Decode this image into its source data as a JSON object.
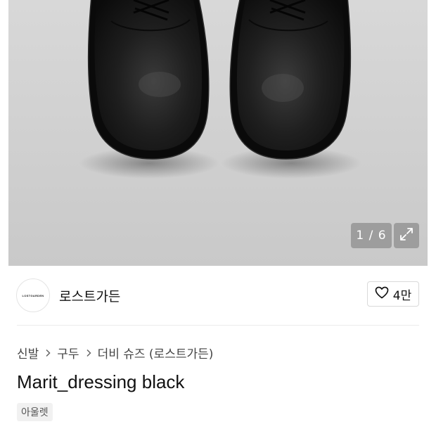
{
  "hero": {
    "image_counter": "1 / 6",
    "expand_icon": "expand-arrows-icon",
    "photo_subject": "black-leather-derby-shoes"
  },
  "brand": {
    "logo_text": "LOSTGARDEN",
    "name": "로스트가든",
    "like_icon": "heart-outline-icon",
    "like_count": "4만"
  },
  "product": {
    "breadcrumb": [
      "신발",
      "구두",
      "더비 슈즈 (로스트가든)"
    ],
    "breadcrumb_separator_icon": "chevron-right-icon",
    "title": "Marit_dressing black",
    "tag": "아울렛"
  },
  "colors": {
    "text_primary": "#111111",
    "text_secondary": "#444444",
    "tag_background": "#f1f1f1",
    "border": "#d9d9d9"
  }
}
